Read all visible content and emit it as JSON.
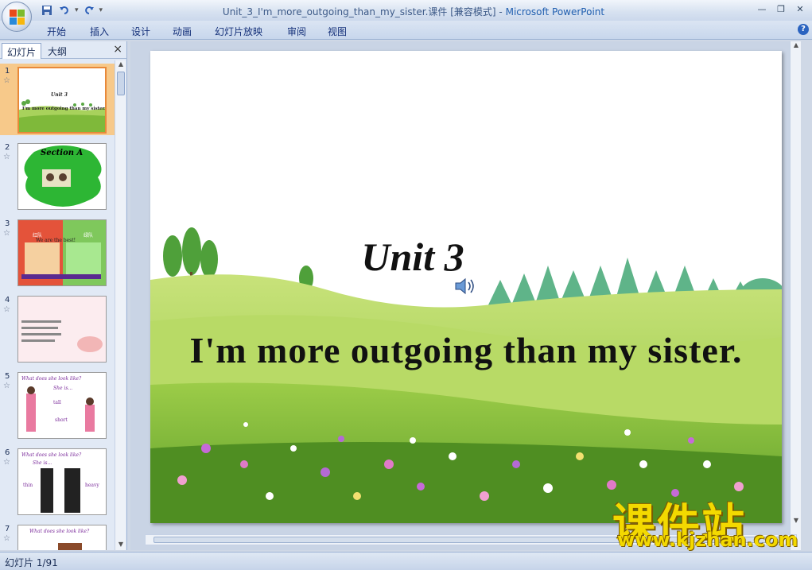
{
  "window": {
    "file_name": "Unit_3_I'm_more_outgoing_than_my_sister.课件",
    "mode": "[兼容模式]",
    "separator": "-",
    "app_name": "Microsoft PowerPoint"
  },
  "ribbon": {
    "tabs": [
      "开始",
      "插入",
      "设计",
      "动画",
      "幻灯片放映",
      "审阅",
      "视图"
    ]
  },
  "left_pane": {
    "tabs": [
      "幻灯片",
      "大纲"
    ],
    "close": "×",
    "thumbnails": [
      {
        "number": "1",
        "title": "Unit 3",
        "subtitle": "I'm more outgoing than my sister."
      },
      {
        "number": "2",
        "title": "Section A",
        "subtitle": ""
      },
      {
        "number": "3",
        "title": "",
        "subtitle": "We are the best!"
      },
      {
        "number": "4",
        "title": "",
        "subtitle": ""
      },
      {
        "number": "5",
        "title": "What does she look like?",
        "subtitle": "She is..."
      },
      {
        "number": "6",
        "title": "What does she look like?",
        "subtitle": "She is..."
      },
      {
        "number": "7",
        "title": "What does she look like?",
        "subtitle": ""
      }
    ],
    "thumb3_labels": {
      "left": "红队",
      "right": "绿队",
      "group1": "Group1: red Numbers: Rows 1-4",
      "group2": "Group2: green Numbers: Rows 5-8"
    },
    "thumb5_labels": {
      "tall": "tall",
      "short": "short"
    },
    "thumb6_labels": {
      "thin": "thin",
      "heavy": "heavy"
    }
  },
  "slide": {
    "title": "Unit 3",
    "subtitle": "I'm more outgoing than my sister."
  },
  "status_bar": {
    "slide_indicator": "幻灯片 1/91"
  },
  "watermark": {
    "text": "课件站",
    "url": "www.kjzhan.com"
  },
  "colors": {
    "ribbon_text": "#15317a",
    "selected_thumb": "#f7c98a",
    "watermark": "#f3d900"
  }
}
